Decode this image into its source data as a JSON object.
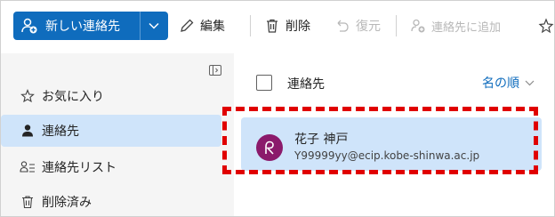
{
  "toolbar": {
    "new_contact": "新しい連絡先",
    "edit": "編集",
    "delete": "削除",
    "restore": "復元",
    "add_to_contacts": "連絡先に追加"
  },
  "nav": {
    "items": [
      {
        "label": "お気に入り",
        "icon": "star-icon"
      },
      {
        "label": "連絡先",
        "icon": "person-icon"
      },
      {
        "label": "連絡先リスト",
        "icon": "people-list-icon"
      },
      {
        "label": "削除済み",
        "icon": "trash-icon"
      }
    ]
  },
  "list": {
    "title": "連絡先",
    "sort_label": "名の順"
  },
  "contacts": [
    {
      "name": "花子 神戸",
      "email": "Y99999yy@ecip.kobe-shinwa.ac.jp",
      "initial": "R",
      "avatar_color": "#8b1a6b"
    }
  ],
  "colors": {
    "accent": "#0f6cbd",
    "selected": "#cfe4fa",
    "highlight": "#e00000"
  }
}
